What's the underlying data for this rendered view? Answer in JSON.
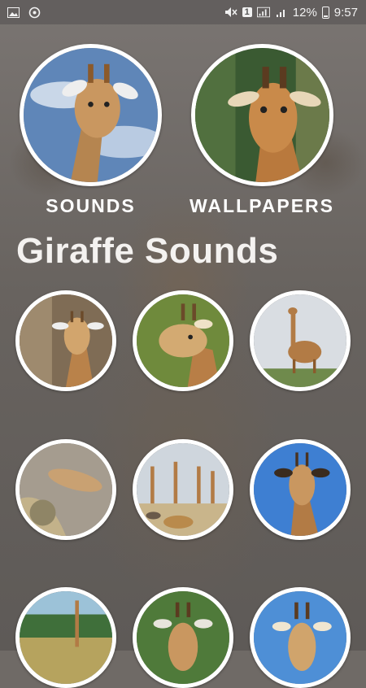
{
  "status_bar": {
    "battery": "12%",
    "time": "9:57",
    "sim_badge": "1",
    "icons": [
      "image-icon",
      "sync-icon",
      "mute-icon",
      "sim-icon",
      "signal-icon",
      "battery-icon"
    ]
  },
  "menu": {
    "sounds_label": "SOUNDS",
    "wallpapers_label": "WALLPAPERS"
  },
  "section": {
    "title": "Giraffe Sounds"
  },
  "colors": {
    "circle_border": "#ffffff",
    "label_text": "#ffffff"
  }
}
